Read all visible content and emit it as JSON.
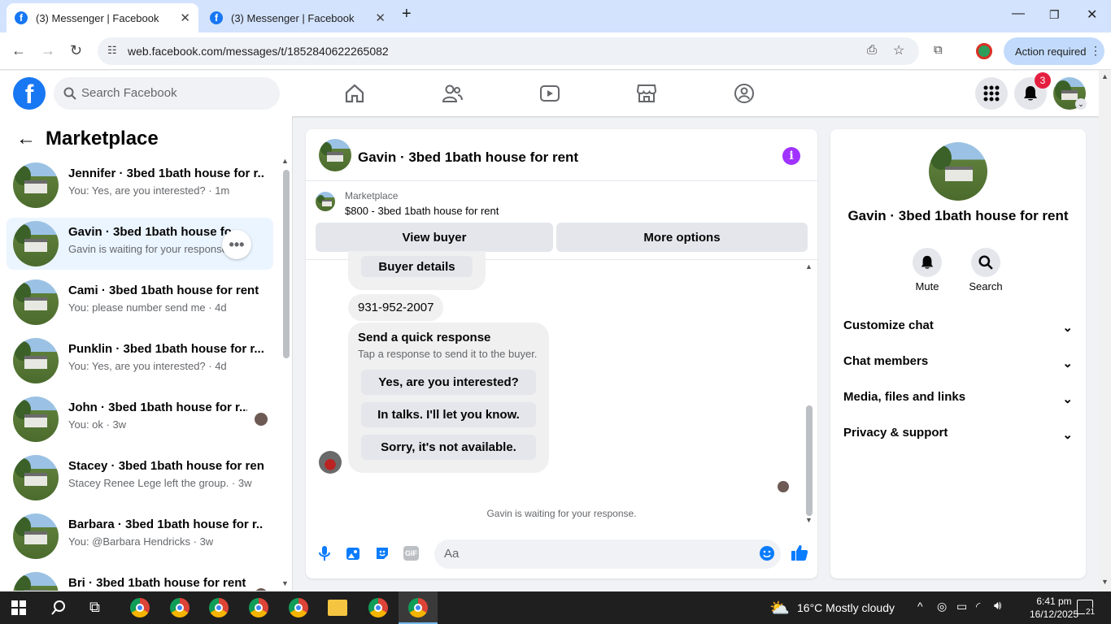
{
  "browser": {
    "tabs": [
      {
        "title": "(3) Messenger | Facebook",
        "active": true
      },
      {
        "title": "(3) Messenger | Facebook",
        "active": false
      }
    ],
    "url": "web.facebook.com/messages/t/1852840622265082",
    "action_required": "Action required"
  },
  "fb": {
    "search_placeholder": "Search Facebook",
    "notification_count": "3"
  },
  "sidebar": {
    "title": "Marketplace",
    "chats": [
      {
        "name": "Jennifer · 3bed 1bath house for r...",
        "preview": "You: Yes, are you interested? · 1m"
      },
      {
        "name": "Gavin · 3bed 1bath house for rent",
        "preview": "Gavin is waiting for your response.",
        "selected": true
      },
      {
        "name": "Cami · 3bed 1bath house for rent",
        "preview": "You: please number send me · 4d"
      },
      {
        "name": "Punklin · 3bed 1bath house for r...",
        "preview": "You: Yes, are you interested? · 4d"
      },
      {
        "name": "John · 3bed 1bath house for r...",
        "preview": "You: ok · 3w"
      },
      {
        "name": "Stacey · 3bed 1bath house for rent",
        "preview": "Stacey Renee Lege left the group. · 3w"
      },
      {
        "name": "Barbara · 3bed 1bath house for r...",
        "preview": "You: @Barbara Hendricks · 3w"
      },
      {
        "name": "Bri · 3bed 1bath house for rent",
        "preview": ""
      }
    ]
  },
  "chat": {
    "title": "Gavin · 3bed 1bath house for rent",
    "listing_source": "Marketplace",
    "listing_price": "$800 - 3bed 1bath house for rent",
    "view_buyer": "View buyer",
    "more_options": "More options",
    "buyer_details": "Buyer details",
    "phone": "931-952-2007",
    "quick_title": "Send a quick response",
    "quick_sub": "Tap a response to send it to the buyer.",
    "quick_responses": [
      "Yes, are you interested?",
      "In talks. I'll let you know.",
      "Sorry, it's not available."
    ],
    "waiting": "Gavin is waiting for your response.",
    "input_placeholder": "Aa"
  },
  "details": {
    "title": "Gavin · 3bed 1bath house for rent",
    "actions": [
      "Mute",
      "Search"
    ],
    "sections": [
      "Customize chat",
      "Chat members",
      "Media, files and links",
      "Privacy & support"
    ]
  },
  "taskbar": {
    "weather": "16°C  Mostly cloudy",
    "time": "6:41 pm",
    "date": "16/12/2025",
    "notif_count": "21"
  }
}
